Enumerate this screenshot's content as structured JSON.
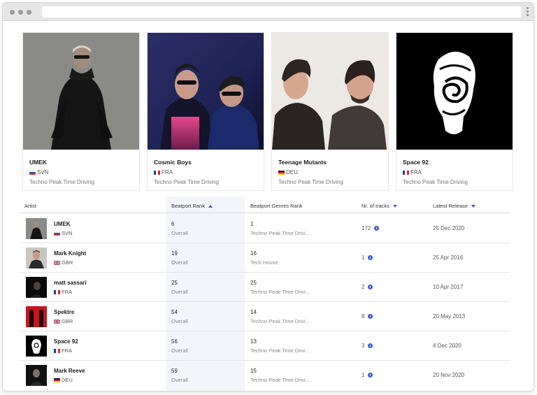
{
  "colors": {
    "accent": "#3b5bd6",
    "highlight_column": "#f3f5fb"
  },
  "cards": [
    {
      "name": "UMEK",
      "country": "SVN",
      "genre": "Techno Peak Time Driving"
    },
    {
      "name": "Cosmic Boys",
      "country": "FRA",
      "genre": "Techno Peak Time Driving"
    },
    {
      "name": "Teenage Mutants",
      "country": "DEU",
      "genre": "Techno Peak Time Driving"
    },
    {
      "name": "Space 92",
      "country": "FRA",
      "genre": "Techno Peak Time Driving"
    }
  ],
  "table": {
    "headers": {
      "artist": "Artist",
      "beatport_rank": "Beatport Rank",
      "genres_rank": "Beatport Genres Rank",
      "tracks": "Nr. of tracks",
      "latest_release": "Latest Release"
    },
    "rows": [
      {
        "name": "UMEK",
        "country": "SVN",
        "rank": "6",
        "rank_sub": "Overall",
        "genre_rank": "1",
        "genre": "Techno Peak Time Drivi...",
        "tracks": "172",
        "date": "25 Dec 2020"
      },
      {
        "name": "Mark Knight",
        "country": "GBR",
        "rank": "19",
        "rank_sub": "Overall",
        "genre_rank": "16",
        "genre": "Tech House",
        "tracks": "1",
        "date": "25 Apr 2016"
      },
      {
        "name": "matt sassari",
        "country": "FRA",
        "rank": "25",
        "rank_sub": "Overall",
        "genre_rank": "25",
        "genre": "Techno Peak Time Drivi...",
        "tracks": "2",
        "date": "10 Apr 2017"
      },
      {
        "name": "Spektre",
        "country": "GBR",
        "rank": "54",
        "rank_sub": "Overall",
        "genre_rank": "14",
        "genre": "Techno Peak Time Drivi...",
        "tracks": "8",
        "date": "20 May 2013"
      },
      {
        "name": "Space 92",
        "country": "FRA",
        "rank": "56",
        "rank_sub": "Overall",
        "genre_rank": "13",
        "genre": "Techno Peak Time Drivi...",
        "tracks": "3",
        "date": "4 Dec 2020"
      },
      {
        "name": "Mark Reeve",
        "country": "DEU",
        "rank": "59",
        "rank_sub": "Overall",
        "genre_rank": "15",
        "genre": "Techno Peak Time Drivi...",
        "tracks": "1",
        "date": "20 Nov 2020"
      }
    ]
  }
}
